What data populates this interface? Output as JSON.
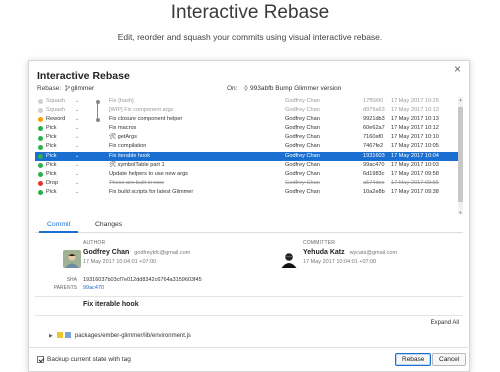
{
  "hero": {
    "title": "Interactive Rebase",
    "subtitle": "Edit, reorder and squash your commits using visual interactive rebase."
  },
  "dialog": {
    "title": "Interactive Rebase",
    "rebase_label": "Rebase:",
    "branch": "glimmer",
    "on_label": "On:",
    "on_value": "993abfb  Bump Glimmer version",
    "close_glyph": "×"
  },
  "commits": [
    {
      "action": "Squash",
      "dot": "#cfcfcf",
      "message": "Fix {hash}",
      "author": "Godfrey Chan",
      "sha": "17f5990",
      "date": "17 May 2017 10:26",
      "faded": true
    },
    {
      "action": "Squash",
      "dot": "#cfcfcf",
      "message": "[WIP] Fix component args",
      "author": "Godfrey Chan",
      "sha": "d979a63",
      "date": "17 May 2017 10:13",
      "faded": true
    },
    {
      "action": "Reword",
      "dot": "#f4a000",
      "message": "Fix closure component helper",
      "author": "Godfrey Chan",
      "sha": "9921db3",
      "date": "17 May 2017 10:13"
    },
    {
      "action": "Pick",
      "dot": "#2bb04a",
      "message": "Fix macros",
      "author": "Godfrey Chan",
      "sha": "60e62a7",
      "date": "17 May 2017 10:12"
    },
    {
      "action": "Pick",
      "dot": "#2bb04a",
      "message": "🛠 getArgs",
      "author": "Godfrey Chan",
      "sha": "7160af0",
      "date": "17 May 2017 10:10"
    },
    {
      "action": "Pick",
      "dot": "#2bb04a",
      "message": "Fix compilation",
      "author": "Godfrey Chan",
      "sha": "7467fe2",
      "date": "17 May 2017 10:05"
    },
    {
      "action": "Pick",
      "dot": "#2bb04a",
      "message": "Fix iterable hook",
      "author": "Godfrey Chan",
      "sha": "1931603",
      "date": "17 May 2017 10:04",
      "selected": true
    },
    {
      "action": "Pick",
      "dot": "#2bb04a",
      "message": "🛠 symbolTable part 1",
      "author": "Godfrey Chan",
      "sha": "99ac470",
      "date": "17 May 2017 10:03"
    },
    {
      "action": "Pick",
      "dot": "#2bb04a",
      "message": "Update helpers to use new args",
      "author": "Godfrey Chan",
      "sha": "6d1983c",
      "date": "17 May 2017 09:58"
    },
    {
      "action": "Drop",
      "dot": "#e0352b",
      "message": "These are built-in now",
      "author": "Godfrey Chan",
      "sha": "a574dec",
      "date": "17 May 2017 09:55",
      "drop": true
    },
    {
      "action": "Pick",
      "dot": "#2bb04a",
      "message": "Fix build scripts for latest Glimmer",
      "author": "Godfrey Chan",
      "sha": "10a2e8b",
      "date": "17 May 2017 09:38"
    }
  ],
  "tabs": [
    "Commit",
    "Changes"
  ],
  "detail": {
    "author_head": "AUTHOR",
    "author_name": "Godfrey Chan",
    "author_email": "godfreykfc@gmail.com",
    "author_date": "17 May 2017 10:04:01 +07:00",
    "committer_head": "COMMITTER",
    "committer_name": "Yehuda Katz",
    "committer_email": "wycats@gmail.com",
    "committer_date": "17 May 2017 10:04:01 +07:00",
    "sha_label": "SHA",
    "sha_value": "19316037b03cf7e012dd8342c6764a3159603f45",
    "parents_label": "PARENTS",
    "parents_value": "99ac470",
    "subject": "Fix iterable hook",
    "expand_all": "Expand All",
    "file_path": "packages/ember-glimmer/lib/environment.js"
  },
  "footer": {
    "backup_label": "Backup current state with tag",
    "rebase_button": "Rebase",
    "cancel_button": "Cancel"
  }
}
